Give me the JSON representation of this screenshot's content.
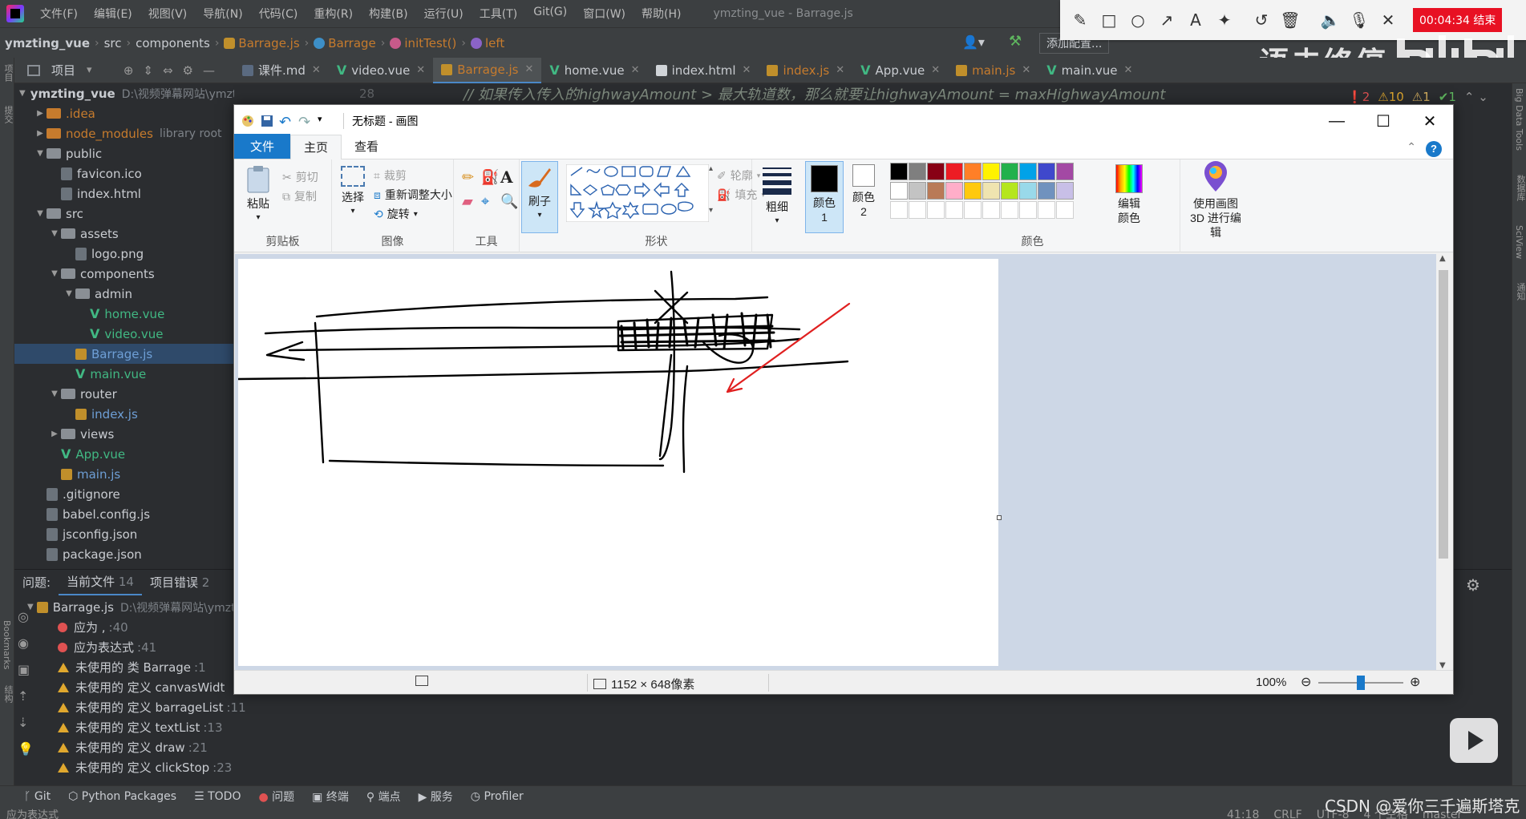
{
  "ide": {
    "menu": [
      "文件(F)",
      "编辑(E)",
      "视图(V)",
      "导航(N)",
      "代码(C)",
      "重构(R)",
      "构建(B)",
      "运行(U)",
      "工具(T)",
      "Git(G)",
      "窗口(W)",
      "帮助(H)"
    ],
    "window_title": "ymzting_vue - Barrage.js",
    "breadcrumb": [
      "ymzting_vue",
      "src",
      "components",
      "Barrage.js",
      "Barrage",
      "initTest()",
      "left"
    ],
    "add_config": "添加配置...",
    "project_label": "项目",
    "tabs": [
      {
        "label": "课件.md",
        "icon": "md"
      },
      {
        "label": "video.vue",
        "icon": "vue"
      },
      {
        "label": "Barrage.js",
        "icon": "js",
        "active": true
      },
      {
        "label": "home.vue",
        "icon": "vue"
      },
      {
        "label": "index.html",
        "icon": "html"
      },
      {
        "label": "index.js",
        "icon": "js"
      },
      {
        "label": "App.vue",
        "icon": "vue"
      },
      {
        "label": "main.js",
        "icon": "js"
      },
      {
        "label": "main.vue",
        "icon": "vue"
      }
    ],
    "code_line_number": "28",
    "code_line": "// 如果传入传入的highwayAmount > 最大轨道数，那么就要让highwayAmount = maxHighwayAmount",
    "inspections": {
      "errors": "2",
      "warnings": "10",
      "weak": "1",
      "ok": "1"
    },
    "tree": [
      {
        "label": "ymzting_vue",
        "hint": "D:\\视频弹幕网站\\ymzting_vue",
        "depth": 0,
        "type": "folder",
        "open": true,
        "bold": true
      },
      {
        "label": ".idea",
        "depth": 1,
        "type": "folder",
        "color": "orange"
      },
      {
        "label": "node_modules",
        "hint": "library root",
        "depth": 1,
        "type": "folder",
        "color": "orange"
      },
      {
        "label": "public",
        "depth": 1,
        "type": "folder",
        "open": true
      },
      {
        "label": "favicon.ico",
        "depth": 2,
        "type": "file"
      },
      {
        "label": "index.html",
        "depth": 2,
        "type": "file"
      },
      {
        "label": "src",
        "depth": 1,
        "type": "folder",
        "open": true
      },
      {
        "label": "assets",
        "depth": 2,
        "type": "folder",
        "open": true
      },
      {
        "label": "logo.png",
        "depth": 3,
        "type": "file"
      },
      {
        "label": "components",
        "depth": 2,
        "type": "folder",
        "open": true
      },
      {
        "label": "admin",
        "depth": 3,
        "type": "folder",
        "open": true
      },
      {
        "label": "home.vue",
        "depth": 4,
        "type": "vue"
      },
      {
        "label": "video.vue",
        "depth": 4,
        "type": "vue"
      },
      {
        "label": "Barrage.js",
        "depth": 3,
        "type": "js",
        "selected": true
      },
      {
        "label": "main.vue",
        "depth": 3,
        "type": "vue"
      },
      {
        "label": "router",
        "depth": 2,
        "type": "folder",
        "open": true
      },
      {
        "label": "index.js",
        "depth": 3,
        "type": "js"
      },
      {
        "label": "views",
        "depth": 2,
        "type": "folder"
      },
      {
        "label": "App.vue",
        "depth": 2,
        "type": "vue"
      },
      {
        "label": "main.js",
        "depth": 2,
        "type": "js"
      },
      {
        "label": ".gitignore",
        "depth": 1,
        "type": "file"
      },
      {
        "label": "babel.config.js",
        "depth": 1,
        "type": "file"
      },
      {
        "label": "jsconfig.json",
        "depth": 1,
        "type": "file"
      },
      {
        "label": "package.json",
        "depth": 1,
        "type": "file"
      }
    ],
    "problems": {
      "header": "问题:",
      "tab_current": "当前文件",
      "tab_current_count": "14",
      "tab_project": "项目错误",
      "tab_project_count": "2",
      "file": "Barrage.js",
      "file_path": "D:\\视频弹幕网站\\ymzting_vue",
      "items": [
        {
          "level": "error",
          "text": "应为 ,",
          "line": ":40"
        },
        {
          "level": "error",
          "text": "应为表达式",
          "line": ":41"
        },
        {
          "level": "warning",
          "text": "未使用的 类 Barrage",
          "line": ":1"
        },
        {
          "level": "warning",
          "text": "未使用的 定义 canvasWidt",
          "line": ""
        },
        {
          "level": "warning",
          "text": "未使用的 定义 barrageList",
          "line": ":11"
        },
        {
          "level": "warning",
          "text": "未使用的 定义 textList",
          "line": ":13"
        },
        {
          "level": "warning",
          "text": "未使用的 定义 draw",
          "line": ":21"
        },
        {
          "level": "warning",
          "text": "未使用的 定义 clickStop",
          "line": ":23"
        }
      ]
    },
    "bottom_tools": [
      "Git",
      "Python Packages",
      "TODO",
      "问题",
      "终端",
      "端点",
      "服务",
      "Profiler"
    ],
    "status_left": "应为表达式",
    "status_right": [
      "41:18",
      "CRLF",
      "UTF-8",
      "4 个空格",
      "master"
    ],
    "right_labels": [
      "Big Data Tools",
      "数据库",
      "SciView",
      "通知"
    ],
    "left_labels": [
      "项目",
      "提交",
      "Bookmarks",
      "结构"
    ]
  },
  "recorder": {
    "timer": "00:04:34 结束"
  },
  "watermark": {
    "text": "语未终停",
    "csdn": "CSDN @爱你三千遍斯塔克"
  },
  "paint": {
    "title": "无标题 - 画图",
    "tabs": {
      "file": "文件",
      "home": "主页",
      "view": "查看"
    },
    "clipboard": {
      "paste": "粘贴",
      "cut": "剪切",
      "copy": "复制",
      "group": "剪贴板"
    },
    "image": {
      "select": "选择",
      "crop": "裁剪",
      "resize": "重新调整大小",
      "rotate": "旋转",
      "group": "图像"
    },
    "tools": {
      "group": "工具"
    },
    "brush": {
      "label": "刷子"
    },
    "shapes": {
      "outline": "轮廓",
      "fill": "填充",
      "group": "形状"
    },
    "size": {
      "label": "粗细"
    },
    "color1": {
      "label": "颜色 1",
      "color": "#000000"
    },
    "color2": {
      "label": "颜色 2",
      "color": "#ffffff"
    },
    "colors_group": "颜色",
    "edit_colors": "编辑颜色",
    "paint3d": "使用画图 3D 进行编辑",
    "palette_row1": [
      "#000000",
      "#7f7f7f",
      "#880015",
      "#ed1c24",
      "#ff7f27",
      "#fff200",
      "#22b14c",
      "#00a2e8",
      "#3f48cc",
      "#a349a4"
    ],
    "palette_row2": [
      "#ffffff",
      "#c3c3c3",
      "#b97a57",
      "#ffaec9",
      "#ffc90e",
      "#efe4b0",
      "#b5e61d",
      "#99d9ea",
      "#7092be",
      "#c8bfe7"
    ],
    "status": {
      "size": "1152 × 648像素",
      "zoom": "100%"
    },
    "zoom_value": 1.0,
    "stroke_color": "#000000",
    "arrow_color": "#e02020"
  }
}
